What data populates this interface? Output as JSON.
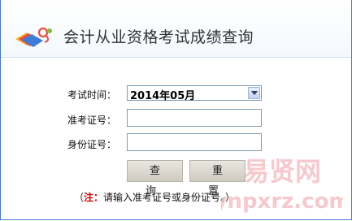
{
  "header": {
    "title": "会计从业资格考试成绩查询",
    "logo_icon": "books-and-ribbon-logo"
  },
  "form": {
    "exam_time_label": "考试时间：",
    "exam_time_value": "2014年05月",
    "admission_label": "准考证号：",
    "admission_value": "",
    "id_label": "身份证号：",
    "id_value": ""
  },
  "buttons": {
    "query": "查 询",
    "reset": "重 置"
  },
  "note": {
    "prefix": "（",
    "emph": "注：",
    "text": "请输入准考证号或身份证号。）"
  },
  "watermark": {
    "line1": "易贤网",
    "line2": "ynpxrz.com"
  },
  "colors": {
    "border": "#3d7bd6",
    "note_red": "#d40000",
    "watermark": "#f4b7bd"
  }
}
